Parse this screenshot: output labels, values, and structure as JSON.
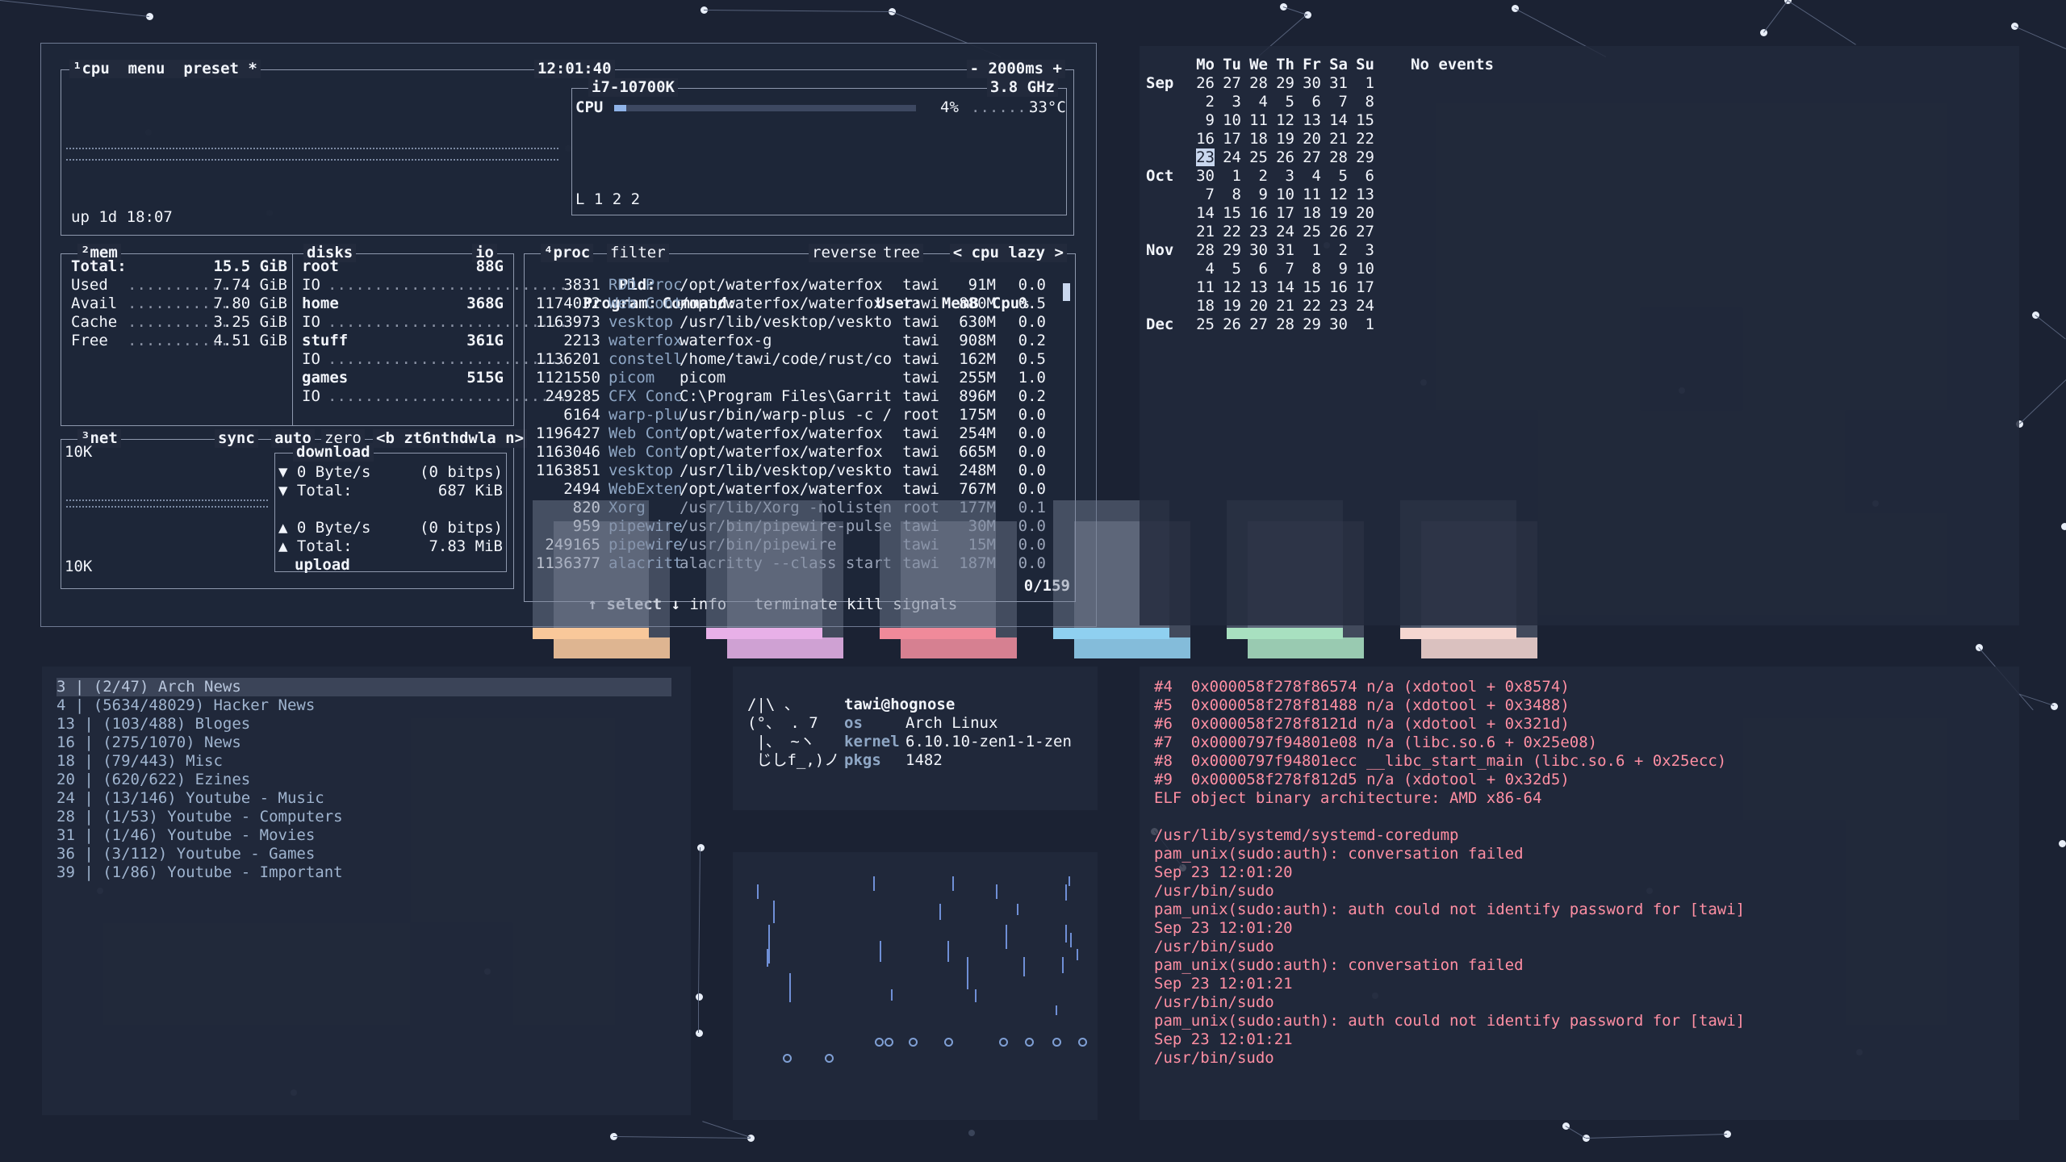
{
  "btop": {
    "cpu_box": {
      "tab_cpu": "¹cpu",
      "tab_menu": "menu",
      "tab_preset": "preset *",
      "clock": "12:01:40",
      "interval": "- 2000ms +",
      "cpu_model": "i7-10700K",
      "freq": "3.8 GHz",
      "cpu_label": "CPU",
      "cpu_percent": "4%",
      "cpu_usage_fraction": 0.04,
      "cpu_temp": "33°C",
      "load": "L 1 2 2",
      "uptime": "up 1d 18:07"
    },
    "mem_box": {
      "title": "²mem",
      "disks_title": "disks",
      "io_title": "io",
      "total_label": "Total:",
      "total_value": "15.5 GiB",
      "rows": [
        {
          "label": "Used",
          "value": "7.74 GiB"
        },
        {
          "label": "Avail",
          "value": "7.80 GiB"
        },
        {
          "label": "Cache",
          "value": "3.25 GiB"
        },
        {
          "label": "Free",
          "value": "4.51 GiB"
        }
      ],
      "disks": [
        {
          "name": "root",
          "size": "88G",
          "io": "IO"
        },
        {
          "name": "home",
          "size": "368G",
          "io": "IO"
        },
        {
          "name": "stuff",
          "size": "361G",
          "io": "IO"
        },
        {
          "name": "games",
          "size": "515G",
          "io": "IO"
        }
      ]
    },
    "net_box": {
      "title": "³net",
      "sync": "sync",
      "auto": "auto",
      "zero": "zero",
      "iface": "<b zt6nthdwla n>",
      "scale_top": "10K",
      "scale_bottom": "10K",
      "download": "download",
      "upload": "upload",
      "dl_rate": "▼ 0 Byte/s",
      "dl_bits": "(0 bitps)",
      "dl_total_label": "▼ Total:",
      "dl_total": "687 KiB",
      "ul_rate": "▲ 0 Byte/s",
      "ul_bits": "(0 bitps)",
      "ul_total_label": "▲ Total:",
      "ul_total": "7.83 MiB"
    },
    "proc_box": {
      "title": "⁴proc",
      "filter": "filter",
      "reverse": "reverse",
      "tree": "tree",
      "sort": "< cpu lazy >",
      "headers": {
        "pid": "Pid:",
        "program": "Program:",
        "command": "Command:",
        "user": "User:",
        "mem": "MemB",
        "cpu": "Cpu%"
      },
      "rows": [
        {
          "pid": "3831",
          "program": "RDD Proc",
          "command": "/opt/waterfox/waterfox",
          "user": "tawi",
          "mem": "91M",
          "cpu": "0.0"
        },
        {
          "pid": "1174032",
          "program": "Web Cont",
          "command": "/opt/waterfox/waterfox",
          "user": "tawi",
          "mem": "880M",
          "cpu": "0.5"
        },
        {
          "pid": "1163973",
          "program": "vesktop",
          "command": "/usr/lib/vesktop/veskto",
          "user": "tawi",
          "mem": "630M",
          "cpu": "0.0"
        },
        {
          "pid": "2213",
          "program": "waterfox",
          "command": "waterfox-g",
          "user": "tawi",
          "mem": "908M",
          "cpu": "0.2"
        },
        {
          "pid": "1136201",
          "program": "constell",
          "command": "/home/tawi/code/rust/co",
          "user": "tawi",
          "mem": "162M",
          "cpu": "0.5"
        },
        {
          "pid": "1121550",
          "program": "picom",
          "command": "picom",
          "user": "tawi",
          "mem": "255M",
          "cpu": "1.0"
        },
        {
          "pid": "249285",
          "program": "CFX Conc",
          "command": "C:\\Program Files\\Garrit",
          "user": "tawi",
          "mem": "896M",
          "cpu": "0.2"
        },
        {
          "pid": "6164",
          "program": "warp-plu",
          "command": "/usr/bin/warp-plus -c /",
          "user": "root",
          "mem": "175M",
          "cpu": "0.0"
        },
        {
          "pid": "1196427",
          "program": "Web Cont",
          "command": "/opt/waterfox/waterfox",
          "user": "tawi",
          "mem": "254M",
          "cpu": "0.0"
        },
        {
          "pid": "1163046",
          "program": "Web Cont",
          "command": "/opt/waterfox/waterfox",
          "user": "tawi",
          "mem": "665M",
          "cpu": "0.0"
        },
        {
          "pid": "1163851",
          "program": "vesktop",
          "command": "/usr/lib/vesktop/veskto",
          "user": "tawi",
          "mem": "248M",
          "cpu": "0.0"
        },
        {
          "pid": "2494",
          "program": "WebExten",
          "command": "/opt/waterfox/waterfox",
          "user": "tawi",
          "mem": "767M",
          "cpu": "0.0"
        },
        {
          "pid": "820",
          "program": "Xorg",
          "command": "/usr/lib/Xorg -nolisten",
          "user": "root",
          "mem": "177M",
          "cpu": "0.1"
        },
        {
          "pid": "959",
          "program": "pipewire",
          "command": "/usr/bin/pipewire-pulse",
          "user": "tawi",
          "mem": "30M",
          "cpu": "0.0"
        },
        {
          "pid": "249165",
          "program": "pipewire",
          "command": "/usr/bin/pipewire",
          "user": "tawi",
          "mem": "15M",
          "cpu": "0.0"
        },
        {
          "pid": "1136377",
          "program": "alacritt",
          "command": "alacritty --class start",
          "user": "tawi",
          "mem": "187M",
          "cpu": "0.0"
        }
      ],
      "footer_select": "↑ select ↓",
      "footer_info": "info",
      "footer_terminate": "terminate",
      "footer_kill": "kill",
      "footer_signals": "signals",
      "footer_count": "0/159"
    }
  },
  "calendar": {
    "weekdays": [
      "Mo",
      "Tu",
      "We",
      "Th",
      "Fr",
      "Sa",
      "Su"
    ],
    "no_events": "No events",
    "rows": [
      {
        "month": "Sep",
        "days": [
          "26",
          "27",
          "28",
          "29",
          "30",
          "31",
          "1"
        ]
      },
      {
        "month": "",
        "days": [
          "2",
          "3",
          "4",
          "5",
          "6",
          "7",
          "8"
        ]
      },
      {
        "month": "",
        "days": [
          "9",
          "10",
          "11",
          "12",
          "13",
          "14",
          "15"
        ]
      },
      {
        "month": "",
        "days": [
          "16",
          "17",
          "18",
          "19",
          "20",
          "21",
          "22"
        ]
      },
      {
        "month": "",
        "days": [
          "23",
          "24",
          "25",
          "26",
          "27",
          "28",
          "29"
        ]
      },
      {
        "month": "Oct",
        "days": [
          "30",
          "1",
          "2",
          "3",
          "4",
          "5",
          "6"
        ]
      },
      {
        "month": "",
        "days": [
          "7",
          "8",
          "9",
          "10",
          "11",
          "12",
          "13"
        ]
      },
      {
        "month": "",
        "days": [
          "14",
          "15",
          "16",
          "17",
          "18",
          "19",
          "20"
        ]
      },
      {
        "month": "",
        "days": [
          "21",
          "22",
          "23",
          "24",
          "25",
          "26",
          "27"
        ]
      },
      {
        "month": "Nov",
        "days": [
          "28",
          "29",
          "30",
          "31",
          "1",
          "2",
          "3"
        ]
      },
      {
        "month": "",
        "days": [
          "4",
          "5",
          "6",
          "7",
          "8",
          "9",
          "10"
        ]
      },
      {
        "month": "",
        "days": [
          "11",
          "12",
          "13",
          "14",
          "15",
          "16",
          "17"
        ]
      },
      {
        "month": "",
        "days": [
          "18",
          "19",
          "20",
          "21",
          "22",
          "23",
          "24"
        ]
      },
      {
        "month": "Dec",
        "days": [
          "25",
          "26",
          "27",
          "28",
          "29",
          "30",
          "1"
        ]
      }
    ],
    "today": "23"
  },
  "feeds": {
    "items": [
      "3 | (2/47) Arch News",
      "4 | (5634/48029) Hacker News",
      "13 | (103/488) Bloges",
      "16 | (275/1070) News",
      "18 | (79/443) Misc",
      "20 | (620/622) Ezines",
      "24 | (13/146) Youtube - Music",
      "28 | (1/53) Youtube - Computers",
      "31 | (1/46) Youtube - Movies",
      "36 | (3/112) Youtube - Games",
      "39 | (1/86) Youtube - Important"
    ]
  },
  "fetch": {
    "ascii": [
      "/|\\ 、",
      "(°、 . 7",
      " |、 ~ヽ",
      " じしf_,)ノ"
    ],
    "user_host": "tawi@hognose",
    "os_label": "os",
    "os_value": "Arch Linux",
    "kernel_label": "kernel",
    "kernel_value": "6.10.10-zen1-1-zen",
    "pkgs_label": "pkgs",
    "pkgs_value": "1482"
  },
  "log": {
    "lines": [
      "#4  0x000058f278f86574 n/a (xdotool + 0x8574)",
      "#5  0x000058f278f81488 n/a (xdotool + 0x3488)",
      "#6  0x000058f278f8121d n/a (xdotool + 0x321d)",
      "#7  0x0000797f94801e08 n/a (libc.so.6 + 0x25e08)",
      "#8  0x0000797f94801ecc __libc_start_main (libc.so.6 + 0x25ecc)",
      "#9  0x000058f278f812d5 n/a (xdotool + 0x32d5)",
      "ELF object binary architecture: AMD x86-64",
      "",
      "/usr/lib/systemd/systemd-coredump",
      "pam_unix(sudo:auth): conversation failed",
      "Sep 23 12:01:20",
      "/usr/bin/sudo",
      "pam_unix(sudo:auth): auth could not identify password for [tawi]",
      "Sep 23 12:01:20",
      "/usr/bin/sudo",
      "pam_unix(sudo:auth): conversation failed",
      "Sep 23 12:01:21",
      "/usr/bin/sudo",
      "pam_unix(sudo:auth): auth could not identify password for [tawi]",
      "Sep 23 12:01:21",
      "/usr/bin/sudo"
    ]
  },
  "colors": {
    "background": "#1b2233",
    "panel": "#222a3c",
    "log_text": "#ff8fa3",
    "feed_text": "#9fb4cf",
    "swatches": [
      "#f9c89a",
      "#e8b0e8",
      "#f08a9a",
      "#8fd0f0",
      "#a8e0c0",
      "#f5d6d0"
    ]
  }
}
